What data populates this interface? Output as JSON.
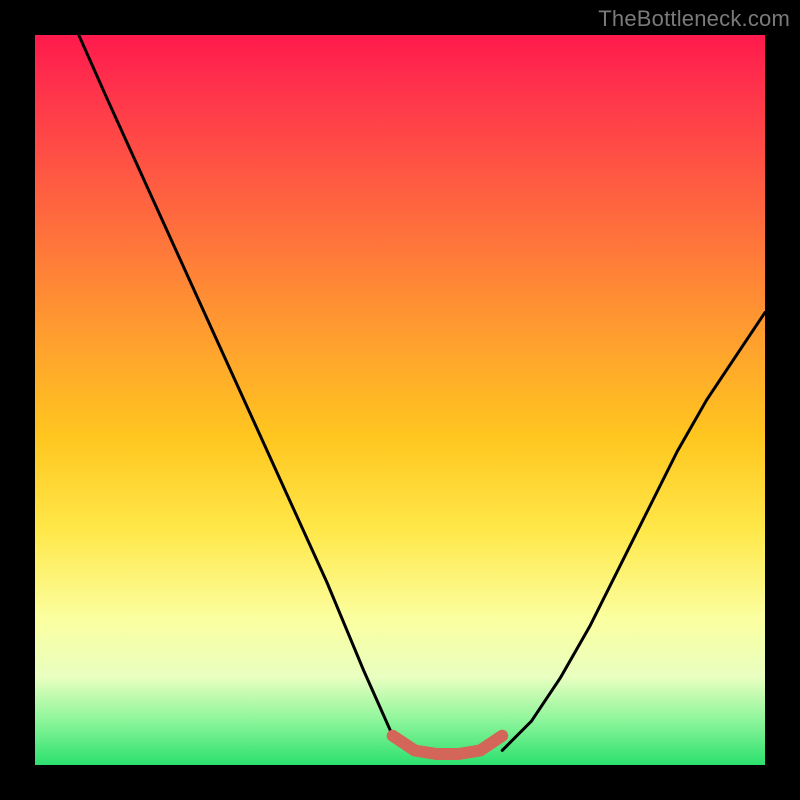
{
  "watermark": "TheBottleneck.com",
  "colors": {
    "background": "#000000",
    "curve": "#000000",
    "highlight": "#d36659",
    "gradient_top": "#ff1a4d",
    "gradient_bottom": "#2be06e"
  },
  "chart_data": {
    "type": "line",
    "title": "",
    "xlabel": "",
    "ylabel": "",
    "xlim": [
      0,
      1
    ],
    "ylim": [
      0,
      1
    ],
    "note": "Axes are unlabeled and normalized 0–1. y=1 at top, y=0 at bottom green band. Values estimated from pixel positions.",
    "series": [
      {
        "name": "left-curve",
        "x": [
          0.06,
          0.1,
          0.15,
          0.2,
          0.25,
          0.3,
          0.35,
          0.4,
          0.45,
          0.49,
          0.52
        ],
        "y": [
          1.0,
          0.91,
          0.8,
          0.69,
          0.58,
          0.47,
          0.36,
          0.25,
          0.13,
          0.04,
          0.02
        ]
      },
      {
        "name": "right-curve",
        "x": [
          0.64,
          0.68,
          0.72,
          0.76,
          0.8,
          0.84,
          0.88,
          0.92,
          0.96,
          1.0
        ],
        "y": [
          0.02,
          0.06,
          0.12,
          0.19,
          0.27,
          0.35,
          0.43,
          0.5,
          0.56,
          0.62
        ]
      },
      {
        "name": "bottom-highlight",
        "x": [
          0.49,
          0.52,
          0.55,
          0.58,
          0.61,
          0.64
        ],
        "y": [
          0.04,
          0.02,
          0.015,
          0.015,
          0.02,
          0.04
        ]
      }
    ]
  }
}
